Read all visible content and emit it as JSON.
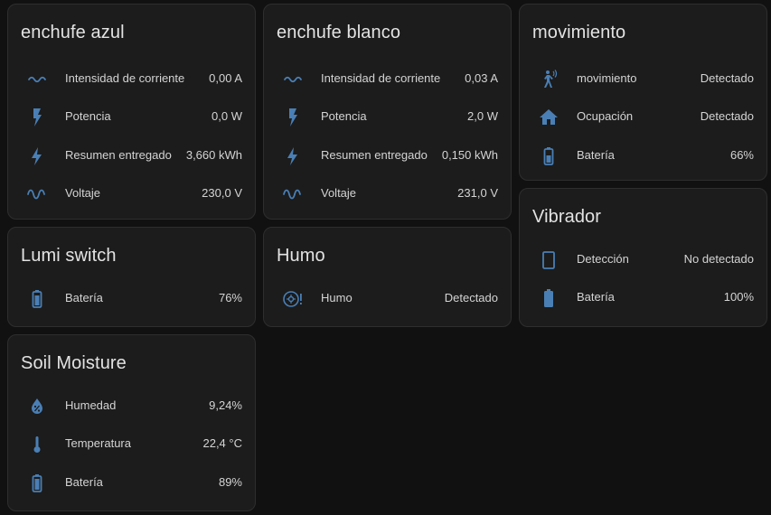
{
  "colors": {
    "background": "#111111",
    "card": "#1c1c1c",
    "icon": "#4a7fb5",
    "text": "#e1e1e1"
  },
  "cards": [
    {
      "title": "enchufe azul",
      "rows": [
        {
          "icon": "current-ac-icon",
          "label": "Intensidad de corriente",
          "value": "0,00 A"
        },
        {
          "icon": "flash-icon",
          "label": "Potencia",
          "value": "0,0 W"
        },
        {
          "icon": "lightning-bolt-icon",
          "label": "Resumen entregado",
          "value": "3,660 kWh"
        },
        {
          "icon": "sine-wave-icon",
          "label": "Voltaje",
          "value": "230,0 V"
        }
      ]
    },
    {
      "title": "enchufe blanco",
      "rows": [
        {
          "icon": "current-ac-icon",
          "label": "Intensidad de corriente",
          "value": "0,03 A"
        },
        {
          "icon": "flash-icon",
          "label": "Potencia",
          "value": "2,0 W"
        },
        {
          "icon": "lightning-bolt-icon",
          "label": "Resumen entregado",
          "value": "0,150 kWh"
        },
        {
          "icon": "sine-wave-icon",
          "label": "Voltaje",
          "value": "231,0 V"
        }
      ]
    },
    {
      "title": "movimiento",
      "rows": [
        {
          "icon": "motion-sensor-icon",
          "label": "movimiento",
          "value": "Detectado"
        },
        {
          "icon": "home-icon",
          "label": "Ocupación",
          "value": "Detectado"
        },
        {
          "icon": "battery-icon",
          "label": "Batería",
          "value": "66%"
        }
      ]
    },
    {
      "title": "Vibrador",
      "rows": [
        {
          "icon": "tablet-outline-icon",
          "label": "Detección",
          "value": "No detectado"
        },
        {
          "icon": "battery-icon",
          "label": "Batería",
          "value": "100%"
        }
      ]
    },
    {
      "title": "Lumi switch",
      "rows": [
        {
          "icon": "battery-icon",
          "label": "Batería",
          "value": "76%"
        }
      ]
    },
    {
      "title": "Humo",
      "rows": [
        {
          "icon": "smoke-detector-alert-icon",
          "label": "Humo",
          "value": "Detectado"
        }
      ]
    },
    {
      "title": "Soil Moisture",
      "rows": [
        {
          "icon": "water-percent-icon",
          "label": "Humedad",
          "value": "9,24%"
        },
        {
          "icon": "thermometer-icon",
          "label": "Temperatura",
          "value": "22,4 °C"
        },
        {
          "icon": "battery-icon",
          "label": "Batería",
          "value": "89%"
        }
      ]
    }
  ]
}
